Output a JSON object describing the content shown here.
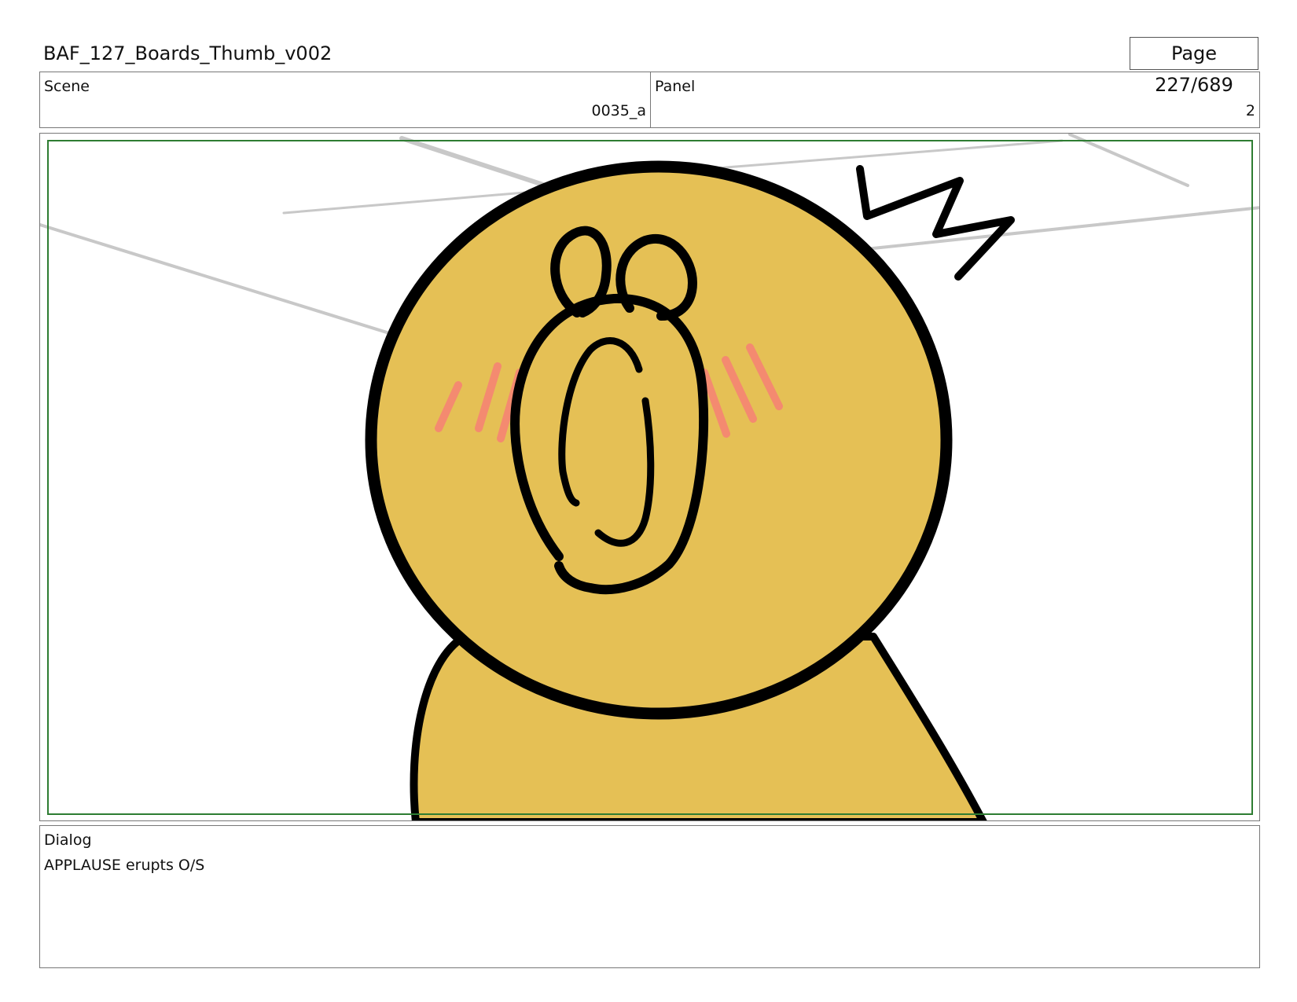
{
  "document": {
    "title": "BAF_127_Boards_Thumb_v002",
    "page_indicator": "Page 227/689"
  },
  "scene": {
    "label": "Scene",
    "value": "0035_a"
  },
  "panel": {
    "label": "Panel",
    "value": "2"
  },
  "dialog": {
    "label": "Dialog",
    "text": "APPLAUSE erupts O/S"
  },
  "colors": {
    "character_fill": "#e5c055",
    "outline": "#000000",
    "blush": "#f48a70",
    "safe_frame": "#2e7d32",
    "background_lines": "#c8c8c8"
  },
  "drawing": {
    "subject": "startled round yellow character with open mouth",
    "icons": [
      "surprise-zigzag-icon"
    ]
  }
}
